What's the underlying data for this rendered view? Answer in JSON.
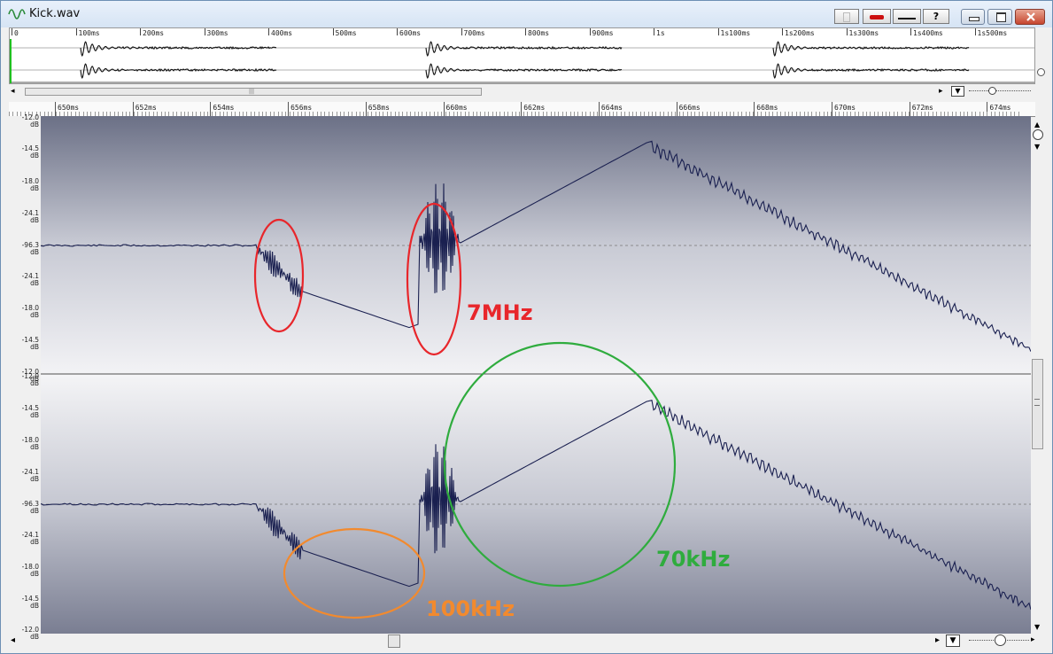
{
  "window": {
    "title": "Kick.wav"
  },
  "toolbar": {
    "help_label": "?"
  },
  "overview": {
    "tick_labels": [
      "0",
      "100ms",
      "200ms",
      "300ms",
      "400ms",
      "500ms",
      "600ms",
      "700ms",
      "800ms",
      "900ms",
      "1s",
      "1s100ms",
      "1s200ms",
      "1s300ms",
      "1s400ms",
      "1s500ms"
    ]
  },
  "ruler": {
    "tick_labels": [
      "650ms",
      "652ms",
      "654ms",
      "656ms",
      "658ms",
      "660ms",
      "662ms",
      "664ms",
      "666ms",
      "668ms",
      "670ms",
      "672ms",
      "674ms"
    ]
  },
  "db_scale": {
    "top_channel": [
      "-12.0",
      "-14.5",
      "-18.0",
      "-24.1",
      "-96.3",
      "-24.1",
      "-18.0",
      "-14.5",
      "-12.0"
    ],
    "bottom_channel": [
      "-12.0",
      "-14.5",
      "-18.0",
      "-24.1",
      "-96.3",
      "-24.1",
      "-18.0",
      "-14.5",
      "-12.0"
    ],
    "unit": "dB"
  },
  "annotations": [
    {
      "text": "7MHz",
      "color": "#e8262b"
    },
    {
      "text": "70kHz",
      "color": "#2fac3e"
    },
    {
      "text": "100kHz",
      "color": "#f28a2e"
    }
  ],
  "colors": {
    "waveform": "#1a2050",
    "ruler_bg": "#fafafa"
  }
}
